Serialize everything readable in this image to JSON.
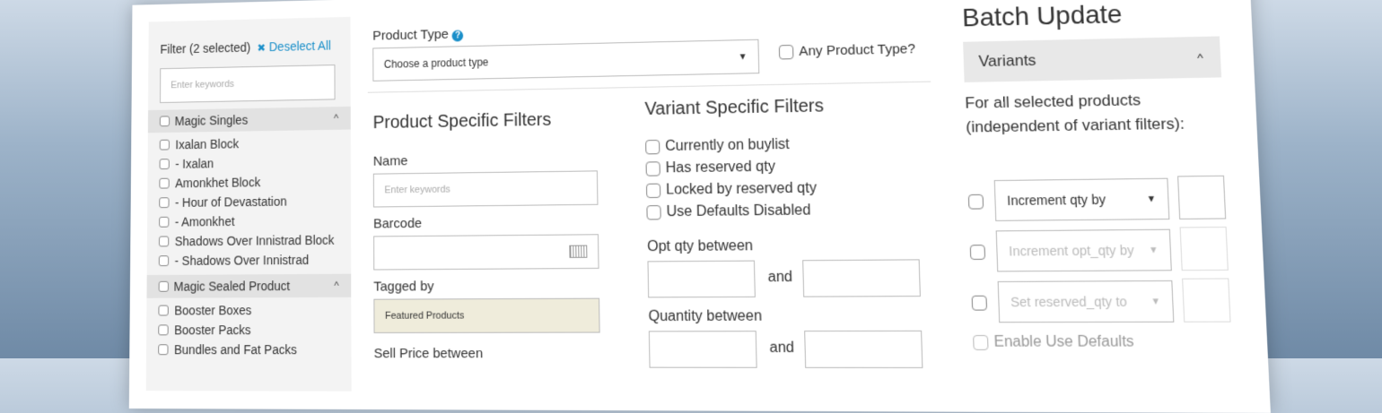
{
  "filter": {
    "title": "Filter (2 selected)",
    "deselect_icon": "✖",
    "deselect_label": "Deselect All",
    "search_placeholder": "Enter keywords"
  },
  "groups": [
    {
      "label": "Magic Singles",
      "items": [
        "Ixalan Block",
        "- Ixalan",
        "Amonkhet Block",
        "- Hour of Devastation",
        "- Amonkhet",
        "Shadows Over Innistrad Block",
        "- Shadows Over Innistrad"
      ]
    },
    {
      "label": "Magic Sealed Product",
      "items": [
        "Booster Boxes",
        "Booster Packs",
        "Bundles and Fat Packs"
      ]
    }
  ],
  "product_type": {
    "label": "Product Type",
    "help_icon": "?",
    "value": "Choose a product type",
    "any_label": "Any Product Type?"
  },
  "product_filters": {
    "title": "Product Specific Filters",
    "name_label": "Name",
    "name_placeholder": "Enter keywords",
    "barcode_label": "Barcode",
    "tagged_label": "Tagged by",
    "tagged_value": "Featured Products",
    "sell_price_label": "Sell Price between"
  },
  "variant_filters": {
    "title": "Variant Specific Filters",
    "checks": [
      "Currently on buylist",
      "Has reserved qty",
      "Locked by reserved qty",
      "Use Defaults Disabled"
    ],
    "opt_qty_label": "Opt qty between",
    "quantity_label": "Quantity between",
    "and_label": "and"
  },
  "batch": {
    "title": "Batch Update",
    "section": "Variants",
    "description": "For all selected products (independent of variant filters):",
    "actions": [
      {
        "label": "Increment qty by",
        "enabled": true
      },
      {
        "label": "Increment opt_qty by",
        "enabled": false
      },
      {
        "label": "Set reserved_qty to",
        "enabled": false
      }
    ],
    "enable_defaults": "Enable Use Defaults"
  },
  "colors": {
    "accent": "#1a8fc9",
    "tag_bg": "#efecdb",
    "panel_bg": "#f3f3f3"
  }
}
